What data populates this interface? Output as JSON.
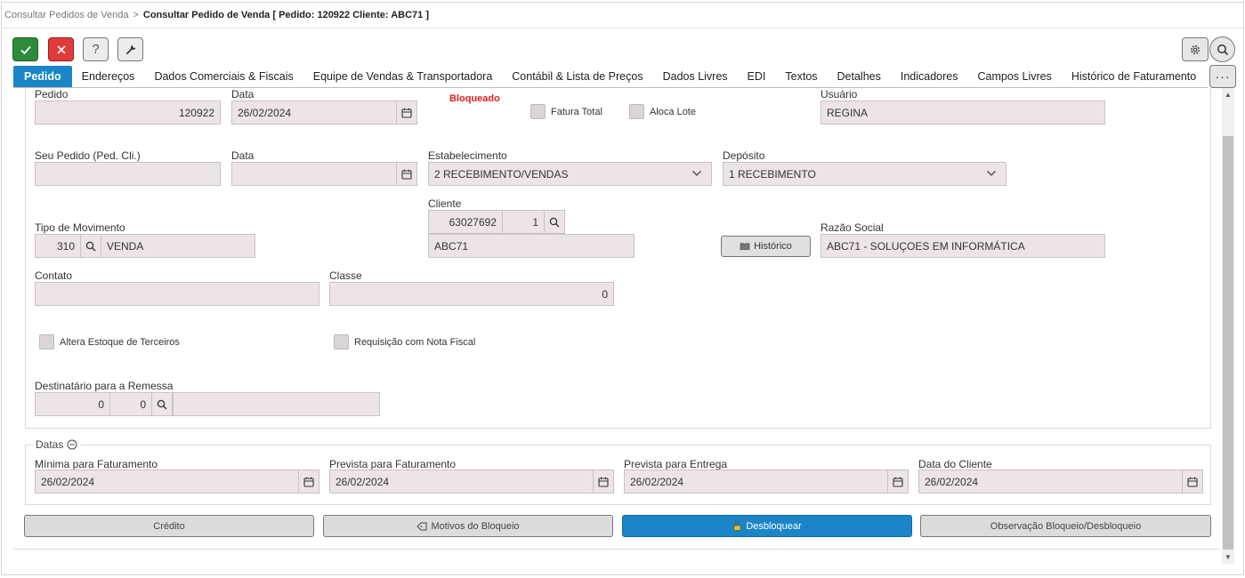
{
  "breadcrumb": {
    "parent": "Consultar Pedidos de Venda",
    "separator": ">",
    "current": "Consultar Pedido de Venda [ Pedido: 120922 Cliente: ABC71 ]"
  },
  "toolbar": {
    "help_label": "?"
  },
  "tabs": [
    {
      "label": "Pedido",
      "active": true
    },
    {
      "label": "Endereços"
    },
    {
      "label": "Dados Comerciais & Fiscais"
    },
    {
      "label": "Equipe de Vendas & Transportadora"
    },
    {
      "label": "Contábil & Lista de Preços"
    },
    {
      "label": "Dados Livres"
    },
    {
      "label": "EDI"
    },
    {
      "label": "Textos"
    },
    {
      "label": "Detalhes"
    },
    {
      "label": "Indicadores"
    },
    {
      "label": "Campos Livres"
    },
    {
      "label": "Histórico de Faturamento"
    }
  ],
  "more_label": "···",
  "form": {
    "pedido_label": "Pedido",
    "pedido_value": "120922",
    "data_label": "Data",
    "data_value": "26/02/2024",
    "status": "Bloqueado",
    "fatura_total_label": "Fatura Total",
    "aloca_lote_label": "Aloca Lote",
    "usuario_label": "Usuário",
    "usuario_value": "REGINA",
    "seu_pedido_label": "Seu Pedido (Ped. Cli.)",
    "seu_pedido_value": "",
    "data2_label": "Data",
    "data2_value": "",
    "estabelecimento_label": "Estabelecimento",
    "estabelecimento_value": "2 RECEBIMENTO/VENDAS",
    "deposito_label": "Depósito",
    "deposito_value": "1 RECEBIMENTO",
    "cliente_label": "Cliente",
    "cliente_code": "63027692",
    "cliente_seq": "1",
    "cliente_name": "ABC71",
    "tipo_mov_label": "Tipo de Movimento",
    "tipo_mov_code": "310",
    "tipo_mov_desc": "VENDA",
    "historico_label": "Histórico",
    "razao_label": "Razão Social",
    "razao_value": "ABC71 - SOLUÇOES EM INFORMÁTICA",
    "contato_label": "Contato",
    "contato_value": "",
    "classe_label": "Classe",
    "classe_value": "0",
    "altera_estoque_label": "Altera Estoque de Terceiros",
    "requisicao_label": "Requisição com Nota Fiscal",
    "destinatario_label": "Destinatário para a Remessa",
    "dest_val1": "0",
    "dest_val2": "0",
    "dest_desc": ""
  },
  "datas": {
    "legend": "Datas",
    "minima_label": "Mínima para Faturamento",
    "minima_value": "26/02/2024",
    "prev_fat_label": "Prevista para Faturamento",
    "prev_fat_value": "26/02/2024",
    "prev_ent_label": "Prevista para Entrega",
    "prev_ent_value": "26/02/2024",
    "cliente_label": "Data do Cliente",
    "cliente_value": "26/02/2024"
  },
  "actions": {
    "credito": "Crédito",
    "motivos": "Motivos do Bloqueio",
    "desbloquear": "Desbloquear",
    "observacao": "Observação Bloqueio/Desbloqueio"
  },
  "colors": {
    "accent": "#1a86c8",
    "ok": "#2e8b3a",
    "cancel": "#e03a3a",
    "status": "#e02020",
    "field_bg": "#ede5e5"
  }
}
